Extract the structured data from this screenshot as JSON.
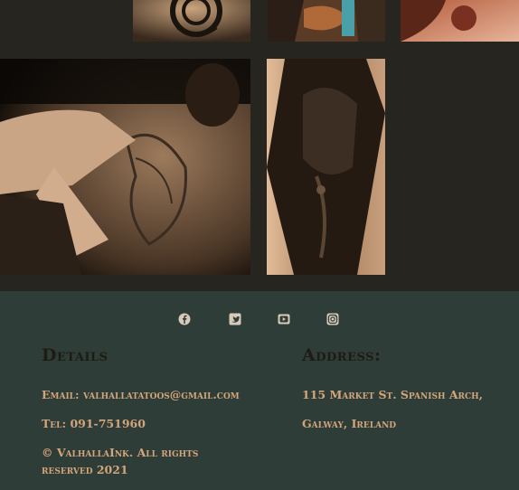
{
  "gallery": {
    "images": [
      {
        "name": "tattoo-image-ornament-shoulder"
      },
      {
        "name": "tattoo-image-koi-sleeve"
      },
      {
        "name": "tattoo-image-red-portrait"
      },
      {
        "name": "tattoo-image-back-piece-in-progress"
      },
      {
        "name": "tattoo-image-viking-warrior"
      }
    ]
  },
  "footer": {
    "socials": [
      "facebook-icon",
      "twitter-icon",
      "youtube-icon",
      "instagram-icon"
    ],
    "details": {
      "title": "Details",
      "email": "Email: valhallatatoos@gmail.com",
      "tel": "Tel: 091-751960",
      "copyright": "© ValhallaInk. All rights reserved 2021"
    },
    "address": {
      "title": "Address:",
      "line1": "115 Market St. Spanish Arch,",
      "line2": "Galway, Ireland"
    }
  },
  "colors": {
    "page_bg": "#262520",
    "footer_bg": "#2e3d37",
    "accent_text": "#d3a57b",
    "heading_text": "#1e1b14",
    "icon": "#d9c9b8"
  }
}
